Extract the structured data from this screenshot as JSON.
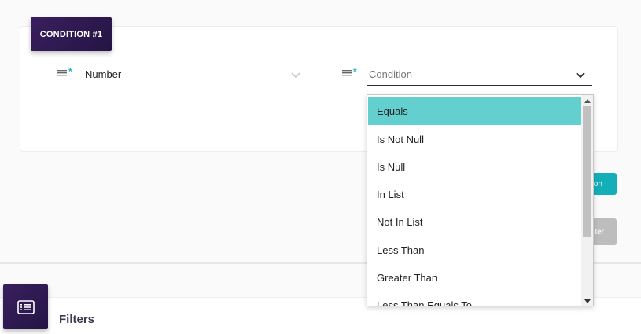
{
  "condition_card": {
    "badge_label": "CONDITION #1",
    "field_left": {
      "value": "Number",
      "icon": "list-icon",
      "required": "*"
    },
    "field_right": {
      "placeholder": "Condition",
      "icon": "list-icon",
      "required": "*"
    }
  },
  "buttons": {
    "teal_partial_label": "on",
    "grey_partial_label": "ter"
  },
  "filters": {
    "title": "Filters",
    "icon": "list-icon"
  },
  "dropdown": {
    "selected_index": 0,
    "options": [
      "Equals",
      "Is Not Null",
      "Is Null",
      "In List",
      "Not In List",
      "Less Than",
      "Greater Than",
      "Less Than Equals To"
    ]
  },
  "colors": {
    "badge_bg": "#2d1a50",
    "accent_teal": "#14aeb8",
    "selected_option": "#64cfcf",
    "required_star": "#21b5c2"
  }
}
